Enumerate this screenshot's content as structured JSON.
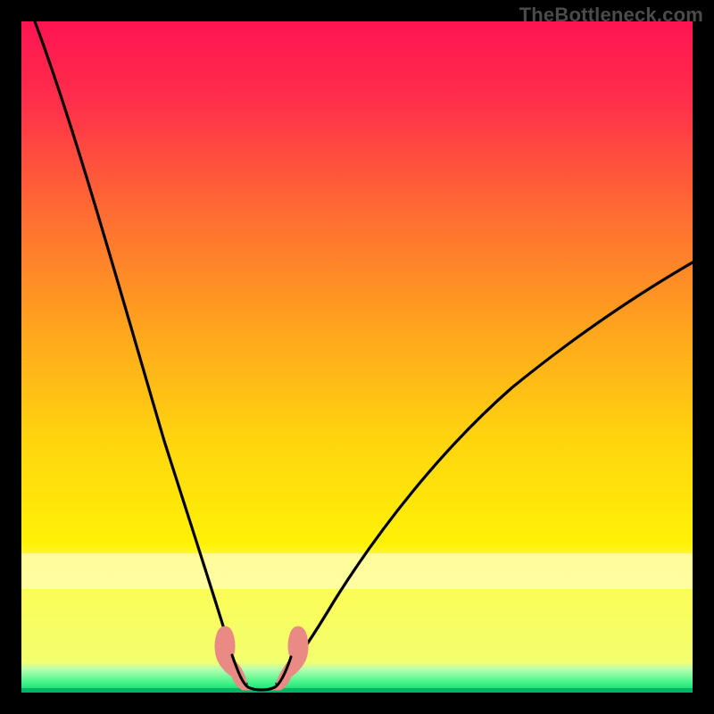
{
  "watermark": "TheBottleneck.com",
  "chart_data": {
    "type": "line",
    "title": "",
    "xlabel": "",
    "ylabel": "",
    "xlim": [
      0,
      100
    ],
    "ylim": [
      0,
      100
    ],
    "background_gradient": {
      "top_color": "#ff1452",
      "mid_color": "#ffe406",
      "bottom_band_color": "#2cf57a",
      "bottom_line_color": "#00c86a"
    },
    "series": [
      {
        "name": "left-curve",
        "x": [
          2,
          5,
          8,
          11,
          14,
          17,
          20,
          23,
          25,
          27,
          29,
          30.5,
          32
        ],
        "y": [
          100,
          91,
          82,
          73,
          64,
          55,
          46,
          36,
          28,
          20,
          12,
          7,
          3
        ]
      },
      {
        "name": "right-curve",
        "x": [
          38,
          40,
          43,
          47,
          52,
          58,
          65,
          73,
          82,
          91,
          100
        ],
        "y": [
          3,
          6,
          11,
          18,
          26,
          34,
          42,
          49,
          55,
          60,
          64
        ]
      },
      {
        "name": "trough-pink-band",
        "x": [
          29,
          30,
          31,
          32,
          33,
          34,
          35,
          36,
          37,
          38,
          39,
          40,
          41
        ],
        "y": [
          9,
          6,
          4,
          2.8,
          2,
          1.8,
          1.8,
          1.8,
          2,
          2.6,
          3.4,
          5,
          7
        ]
      }
    ],
    "colors": {
      "curve": "#000000",
      "pink_band": "#e98a84"
    }
  }
}
